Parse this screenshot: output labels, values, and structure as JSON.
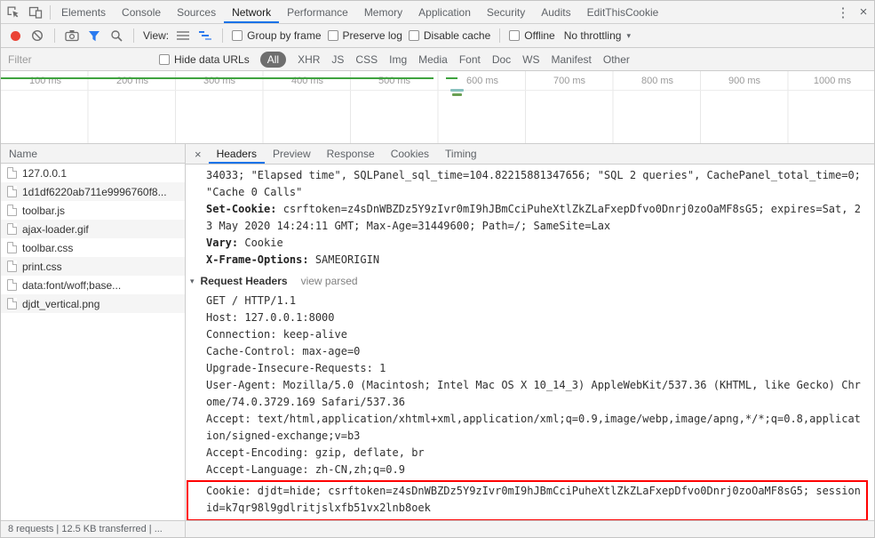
{
  "window": {
    "tabs": [
      "Elements",
      "Console",
      "Sources",
      "Network",
      "Performance",
      "Memory",
      "Application",
      "Security",
      "Audits",
      "EditThisCookie"
    ],
    "active_tab": "Network"
  },
  "icons": {
    "more_options": "⋮",
    "close": "×",
    "dropdown_caret": "▾",
    "disclosure_triangle": "▾"
  },
  "network_toolbar": {
    "view_label": "View:",
    "group_by_frame": "Group by frame",
    "preserve_log": "Preserve log",
    "disable_cache": "Disable cache",
    "offline": "Offline",
    "throttling": "No throttling"
  },
  "filter_bar": {
    "filter_placeholder": "Filter",
    "hide_data_urls": "Hide data URLs",
    "types": [
      "All",
      "XHR",
      "JS",
      "CSS",
      "Img",
      "Media",
      "Font",
      "Doc",
      "WS",
      "Manifest",
      "Other"
    ],
    "active_type": "All"
  },
  "overview": {
    "ticks": [
      "100 ms",
      "200 ms",
      "300 ms",
      "400 ms",
      "500 ms",
      "600 ms",
      "700 ms",
      "800 ms",
      "900 ms",
      "1000 ms"
    ]
  },
  "requests_panel": {
    "column_header": "Name",
    "rows": [
      {
        "name": "127.0.0.1",
        "icon": "document-icon"
      },
      {
        "name": "1d1df6220ab711e9996760f8...",
        "icon": "image-icon"
      },
      {
        "name": "toolbar.js",
        "icon": "script-icon"
      },
      {
        "name": "ajax-loader.gif",
        "icon": "image-icon"
      },
      {
        "name": "toolbar.css",
        "icon": "stylesheet-icon"
      },
      {
        "name": "print.css",
        "icon": "stylesheet-icon"
      },
      {
        "name": "data:font/woff;base...",
        "icon": "font-icon"
      },
      {
        "name": "djdt_vertical.png",
        "icon": "image-icon"
      }
    ]
  },
  "details_panel": {
    "tabs": [
      "Headers",
      "Preview",
      "Response",
      "Cookies",
      "Timing"
    ],
    "active_tab": "Headers",
    "headers": {
      "overflow_line": "34033; \"Elapsed time\", SQLPanel_sql_time=104.82215881347656; \"SQL 2 queries\", CachePanel_total_time=0; \"Cache 0 Calls\"",
      "response_headers": [
        {
          "name": "Set-Cookie:",
          "value": "csrftoken=z4sDnWBZDz5Y9zIvr0mI9hJBmCciPuheXtlZkZLaFxepDfvo0Dnrj0zoOaMF8sG5; expires=Sat, 23 May 2020 14:24:11 GMT; Max-Age=31449600; Path=/; SameSite=Lax"
        },
        {
          "name": "Vary:",
          "value": "Cookie"
        },
        {
          "name": "X-Frame-Options:",
          "value": "SAMEORIGIN"
        }
      ],
      "request_headers_title": "Request Headers",
      "view_parsed_label": "view parsed",
      "request_lines": [
        "GET / HTTP/1.1",
        "Host: 127.0.0.1:8000",
        "Connection: keep-alive",
        "Cache-Control: max-age=0",
        "Upgrade-Insecure-Requests: 1",
        "User-Agent: Mozilla/5.0 (Macintosh; Intel Mac OS X 10_14_3) AppleWebKit/537.36 (KHTML, like Gecko) Chrome/74.0.3729.169 Safari/537.36",
        "Accept: text/html,application/xhtml+xml,application/xml;q=0.9,image/webp,image/apng,*/*;q=0.8,application/signed-exchange;v=b3",
        "Accept-Encoding: gzip, deflate, br",
        "Accept-Language: zh-CN,zh;q=0.9",
        "Cookie: djdt=hide; csrftoken=z4sDnWBZDz5Y9zIvr0mI9hJBmCciPuheXtlZkZLaFxepDfvo0Dnrj0zoOaMF8sG5; sessionid=k7qr98l9gdlritjslxfb51vx2lnb8oek"
      ]
    }
  },
  "status_bar": {
    "text": "8 requests | 12.5 KB transferred | ..."
  },
  "colors": {
    "accent_blue": "#1a73e8",
    "record_red": "#ea4335",
    "highlight_red": "#ff0000",
    "timeline_green": "#3fa33f"
  }
}
